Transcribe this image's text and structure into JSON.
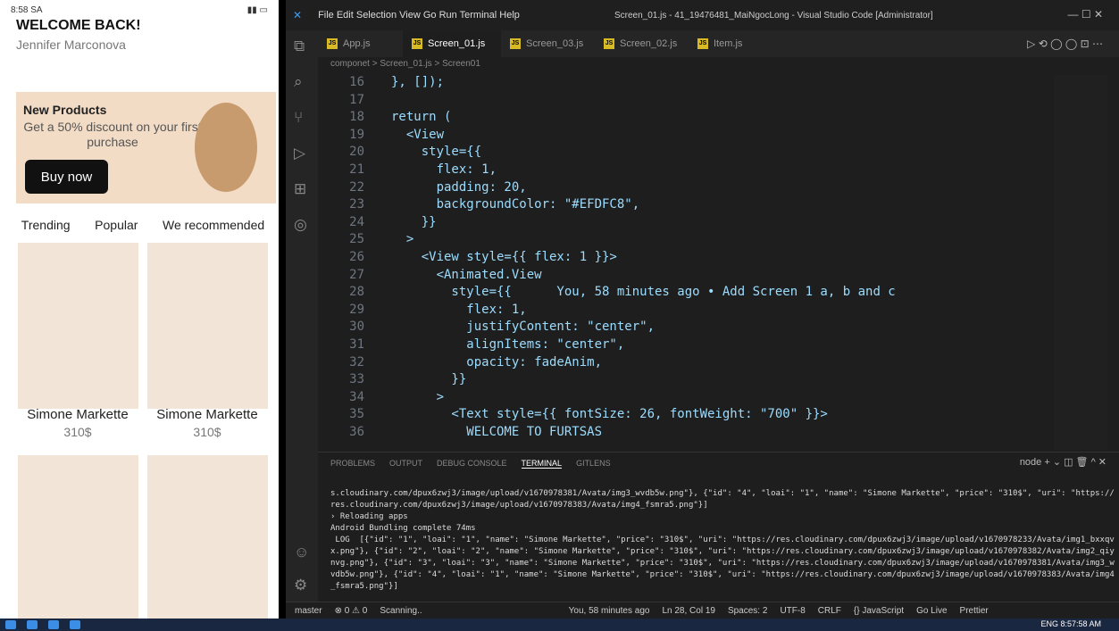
{
  "phone": {
    "time": "8:58 SA",
    "welcome": "WELCOME BACK!",
    "user": "Jennifer Marconova",
    "promo_title": "New Products",
    "promo_desc": "Get a 50% discount on your first purchase",
    "buy": "Buy now",
    "tabs": [
      "Trending",
      "Popular",
      "We recommended"
    ],
    "products": [
      {
        "name": "Simone Markette",
        "price": "310$"
      },
      {
        "name": "Simone Markette",
        "price": "310$"
      }
    ]
  },
  "vscode": {
    "menu": "File   Edit   Selection   View   Go   Run   Terminal   Help",
    "title": "Screen_01.js - 41_19476481_MaiNgocLong - Visual Studio Code [Administrator]",
    "tabs": [
      "App.js",
      "Screen_01.js",
      "Screen_03.js",
      "Screen_02.js",
      "Item.js"
    ],
    "breadcrumb": "componet > Screen_01.js > Screen01",
    "lines": [
      [
        "16",
        "}, []);"
      ],
      [
        "17",
        ""
      ],
      [
        "18",
        "return ("
      ],
      [
        "19",
        "  <View"
      ],
      [
        "20",
        "    style={{"
      ],
      [
        "21",
        "      flex: 1,"
      ],
      [
        "22",
        "      padding: 20,"
      ],
      [
        "23",
        "      backgroundColor: \"#EFDFC8\","
      ],
      [
        "24",
        "    }}"
      ],
      [
        "25",
        "  >"
      ],
      [
        "26",
        "    <View style={{ flex: 1 }}>"
      ],
      [
        "27",
        "      <Animated.View"
      ],
      [
        "28",
        "        style={{      You, 58 minutes ago • Add Screen 1 a, b and c"
      ],
      [
        "29",
        "          flex: 1,"
      ],
      [
        "30",
        "          justifyContent: \"center\","
      ],
      [
        "31",
        "          alignItems: \"center\","
      ],
      [
        "32",
        "          opacity: fadeAnim,"
      ],
      [
        "33",
        "        }}"
      ],
      [
        "34",
        "      >"
      ],
      [
        "35",
        "        <Text style={{ fontSize: 26, fontWeight: \"700\" }}>"
      ],
      [
        "36",
        "          WELCOME TO FURTSAS"
      ]
    ],
    "panel_tabs": [
      "PROBLEMS",
      "OUTPUT",
      "DEBUG CONSOLE",
      "TERMINAL",
      "GITLENS"
    ],
    "terminal": "s.cloudinary.com/dpux6zwj3/image/upload/v1670978381/Avata/img3_wvdb5w.png\"}, {\"id\": \"4\", \"loai\": \"1\", \"name\": \"Simone Markette\", \"price\": \"310$\", \"uri\": \"https://res.cloudinary.com/dpux6zwj3/image/upload/v1670978383/Avata/img4_fsmra5.png\"}]\n› Reloading apps\nAndroid Bundling complete 74ms\n LOG  [{\"id\": \"1\", \"loai\": \"1\", \"name\": \"Simone Markette\", \"price\": \"310$\", \"uri\": \"https://res.cloudinary.com/dpux6zwj3/image/upload/v1670978233/Avata/img1_bxxqvx.png\"}, {\"id\": \"2\", \"loai\": \"2\", \"name\": \"Simone Markette\", \"price\": \"310$\", \"uri\": \"https://res.cloudinary.com/dpux6zwj3/image/upload/v1670978382/Avata/img2_qiynvg.png\"}, {\"id\": \"3\", \"loai\": \"3\", \"name\": \"Simone Markette\", \"price\": \"310$\", \"uri\": \"https://res.cloudinary.com/dpux6zwj3/image/upload/v1670978381/Avata/img3_wvdb5w.png\"}, {\"id\": \"4\", \"loai\": \"1\", \"name\": \"Simone Markette\", \"price\": \"310$\", \"uri\": \"https://res.cloudinary.com/dpux6zwj3/image/upload/v1670978383/Avata/img4_fsmra5.png\"}]",
    "status": [
      "master",
      "⊗ 0 ⚠ 0",
      "Scanning..",
      "You, 58 minutes ago",
      "Ln 28, Col 19",
      "Spaces: 2",
      "UTF-8",
      "CRLF",
      "{} JavaScript",
      "Go Live",
      "Prettier"
    ],
    "tray": "ENG  8:57:58 AM"
  }
}
